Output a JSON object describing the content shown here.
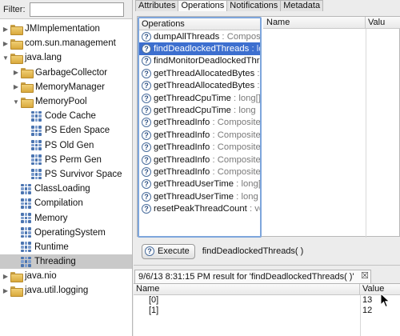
{
  "filter": {
    "label": "Filter:",
    "value": ""
  },
  "tree": [
    {
      "label": "JMImplementation",
      "kind": "folder",
      "level": 0,
      "expanded": false
    },
    {
      "label": "com.sun.management",
      "kind": "folder",
      "level": 0,
      "expanded": false
    },
    {
      "label": "java.lang",
      "kind": "folder",
      "level": 0,
      "expanded": true
    },
    {
      "label": "GarbageCollector",
      "kind": "folder",
      "level": 1,
      "expanded": false
    },
    {
      "label": "MemoryManager",
      "kind": "folder",
      "level": 1,
      "expanded": false
    },
    {
      "label": "MemoryPool",
      "kind": "folder",
      "level": 1,
      "expanded": true
    },
    {
      "label": "Code Cache",
      "kind": "bean",
      "level": 2
    },
    {
      "label": "PS Eden Space",
      "kind": "bean",
      "level": 2
    },
    {
      "label": "PS Old Gen",
      "kind": "bean",
      "level": 2
    },
    {
      "label": "PS Perm Gen",
      "kind": "bean",
      "level": 2
    },
    {
      "label": "PS Survivor Space",
      "kind": "bean",
      "level": 2
    },
    {
      "label": "ClassLoading",
      "kind": "bean",
      "level": 1
    },
    {
      "label": "Compilation",
      "kind": "bean",
      "level": 1
    },
    {
      "label": "Memory",
      "kind": "bean",
      "level": 1
    },
    {
      "label": "OperatingSystem",
      "kind": "bean",
      "level": 1
    },
    {
      "label": "Runtime",
      "kind": "bean",
      "level": 1
    },
    {
      "label": "Threading",
      "kind": "bean",
      "level": 1,
      "selected": true
    },
    {
      "label": "java.nio",
      "kind": "folder",
      "level": 0,
      "expanded": false
    },
    {
      "label": "java.util.logging",
      "kind": "folder",
      "level": 0,
      "expanded": false
    }
  ],
  "tabs": [
    "Attributes",
    "Operations",
    "Notifications",
    "Metadata"
  ],
  "active_tab": "Operations",
  "operations": {
    "header": "Operations",
    "items": [
      {
        "name": "dumpAllThreads",
        "type": "Composite"
      },
      {
        "name": "findDeadlockedThreads",
        "type": "lo",
        "selected": true
      },
      {
        "name": "findMonitorDeadlockedThre",
        "type": ""
      },
      {
        "name": "getThreadAllocatedBytes",
        "type": "lo"
      },
      {
        "name": "getThreadAllocatedBytes",
        "type": "lo"
      },
      {
        "name": "getThreadCpuTime",
        "type": "long[]"
      },
      {
        "name": "getThreadCpuTime",
        "type": "long"
      },
      {
        "name": "getThreadInfo",
        "type": "CompositeD"
      },
      {
        "name": "getThreadInfo",
        "type": "CompositeD"
      },
      {
        "name": "getThreadInfo",
        "type": "CompositeD"
      },
      {
        "name": "getThreadInfo",
        "type": "CompositeD"
      },
      {
        "name": "getThreadInfo",
        "type": "CompositeD"
      },
      {
        "name": "getThreadUserTime",
        "type": "long[]"
      },
      {
        "name": "getThreadUserTime",
        "type": "long"
      },
      {
        "name": "resetPeakThreadCount",
        "type": "voi"
      }
    ]
  },
  "params": {
    "name_header": "Name",
    "value_header": "Valu"
  },
  "execute": {
    "button_label": "Execute",
    "signature": "findDeadlockedThreads( )"
  },
  "result": {
    "tab_label": "9/6/13 8:31:15 PM result for 'findDeadlockedThreads( )'",
    "close_glyph": "☒",
    "name_header": "Name",
    "value_header": "Value",
    "rows": [
      {
        "name": "[0]",
        "value": "13"
      },
      {
        "name": "[1]",
        "value": "12"
      }
    ]
  },
  "colors": {
    "selection": "#3d6fcf",
    "focus_border": "#7ea6dc",
    "folder": "#e6bb55",
    "bean": "#4a74b0"
  }
}
